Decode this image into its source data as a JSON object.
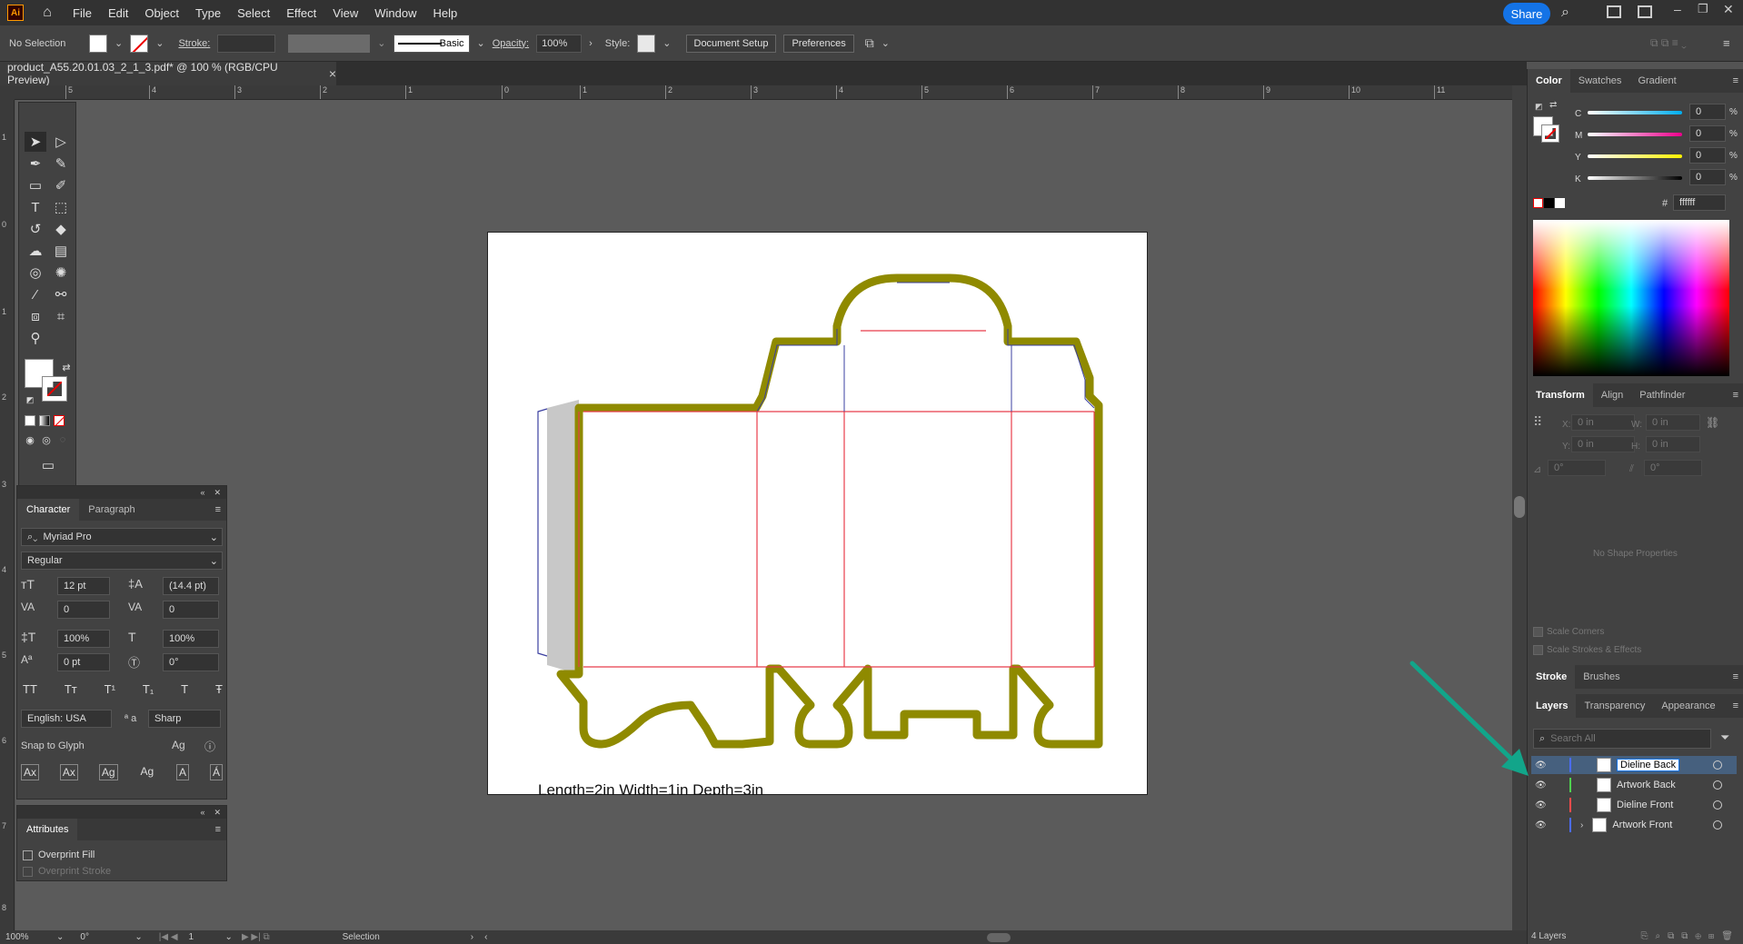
{
  "menubar": {
    "logo": "Ai",
    "items": [
      "File",
      "Edit",
      "Object",
      "Type",
      "Select",
      "Effect",
      "View",
      "Window",
      "Help"
    ],
    "share": "Share"
  },
  "controlbar": {
    "selection": "No Selection",
    "stroke_label": "Stroke:",
    "brush": "Basic",
    "opacity_label": "Opacity:",
    "opacity_value": "100%",
    "style_label": "Style:",
    "document_setup": "Document Setup",
    "preferences": "Preferences"
  },
  "document": {
    "tab_title": "product_A55.20.01.03_2_1_3.pdf* @ 100 % (RGB/CPU Preview)",
    "close": "×",
    "caption": "Length=2in Width=1in Depth=3in"
  },
  "ruler": {
    "h_labels": [
      "5",
      "4",
      "3",
      "2",
      "1",
      "0",
      "1",
      "2",
      "3",
      "4",
      "5",
      "6",
      "7",
      "8",
      "9",
      "10",
      "11"
    ],
    "v_labels": [
      "1",
      "0",
      "1",
      "2",
      "3",
      "4",
      "5",
      "6",
      "7",
      "8"
    ]
  },
  "character": {
    "tab_character": "Character",
    "tab_paragraph": "Paragraph",
    "font_family": "Myriad Pro",
    "font_style": "Regular",
    "size": "12 pt",
    "leading": "(14.4 pt)",
    "kerning": "0",
    "tracking": "0",
    "vscale": "100%",
    "hscale": "100%",
    "baseline": "0 pt",
    "rotation": "0°",
    "language": "English: USA",
    "antialias": "Sharp",
    "aa_label": "ª a",
    "snap_to_glyph": "Snap to Glyph",
    "tt_buttons": [
      "TT",
      "Tт",
      "T¹",
      "T₁",
      "T",
      "Ŧ"
    ],
    "glyph_buttons": [
      "Ax",
      "Ax",
      "Ag",
      "Ag",
      "A",
      "Á"
    ]
  },
  "attributes": {
    "title": "Attributes",
    "overprint_fill": "Overprint Fill",
    "overprint_stroke": "Overprint Stroke"
  },
  "color_panel": {
    "tabs": [
      "Color",
      "Swatches",
      "Gradient"
    ],
    "channels": [
      {
        "label": "C",
        "value": "0",
        "unit": "%"
      },
      {
        "label": "M",
        "value": "0",
        "unit": "%"
      },
      {
        "label": "Y",
        "value": "0",
        "unit": "%"
      },
      {
        "label": "K",
        "value": "0",
        "unit": "%"
      }
    ],
    "hex_label": "#",
    "hex": "ffffff"
  },
  "transform_panel": {
    "tabs": [
      "Transform",
      "Align",
      "Pathfinder"
    ],
    "x_label": "X:",
    "x_value": "0 in",
    "y_label": "Y:",
    "y_value": "0 in",
    "w_label": "W:",
    "w_value": "0 in",
    "h_label": "H:",
    "h_value": "0 in",
    "angle1": "0°",
    "angle2": "0°",
    "no_shape": "No Shape Properties",
    "scale_corners": "Scale Corners",
    "scale_strokes": "Scale Strokes & Effects"
  },
  "stroke_panel": {
    "tabs": [
      "Stroke",
      "Brushes"
    ]
  },
  "layers_panel": {
    "tabs": [
      "Layers",
      "Transparency",
      "Appearance"
    ],
    "search_placeholder": "Search All",
    "layers": [
      {
        "name": "Dieline Back",
        "color": "#4b6cff",
        "selected": true
      },
      {
        "name": "Artwork Back",
        "color": "#4fd14f",
        "selected": false
      },
      {
        "name": "Dieline Front",
        "color": "#ff4b4b",
        "selected": false
      },
      {
        "name": "Artwork Front",
        "color": "#4b6cff",
        "selected": false
      }
    ],
    "count": "4 Layers"
  },
  "statusbar": {
    "zoom": "100%",
    "rotation": "0°",
    "artboard": "1",
    "tool": "Selection"
  },
  "colors": {
    "dieline_olive": "#8f8a00",
    "fold_red": "#e83c4b",
    "cut_blue": "#3b3fa0",
    "accent_blue": "#1473e6",
    "arrow_teal": "#12a58a"
  }
}
